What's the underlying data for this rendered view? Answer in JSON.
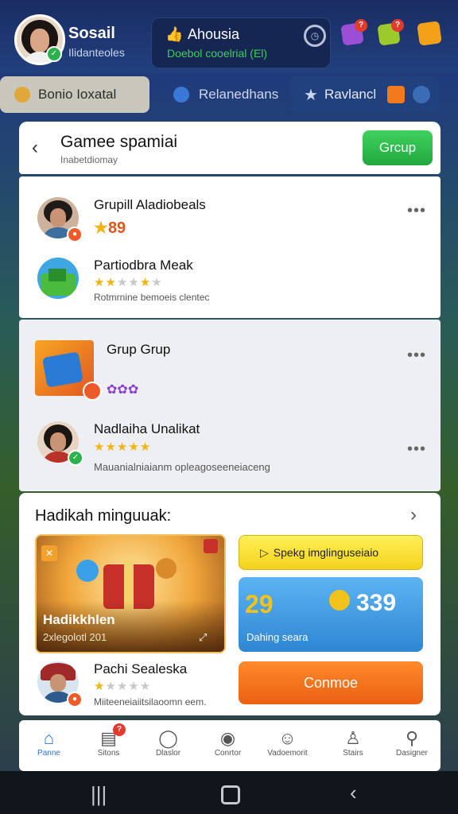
{
  "header": {
    "user_name": "Sosail",
    "user_sub": "Ilidanteoles",
    "status_title": "Ahousia",
    "status_sub": "Doebol cooelrial (El)",
    "gem_badges": [
      "?",
      "?"
    ]
  },
  "tabs": [
    {
      "label": "Bonio Ioxatal"
    },
    {
      "label": "Relanedhans"
    },
    {
      "label": "Ravlancl"
    }
  ],
  "main": {
    "title": "Gamee spamiai",
    "subtitle": "Inabetdiomay",
    "group_button": "Grcup"
  },
  "rows": [
    {
      "title": "Grupill Aladiobeals",
      "score": "89",
      "more": "•••"
    },
    {
      "title": "Partiodbra Meak",
      "sub": "Rotmrnine bemoeis clentec",
      "rating": 3
    },
    {
      "title": "Grup Grup",
      "more": "•••"
    },
    {
      "title": "Nadlaiha Unalikat",
      "sub": "Mauanialniaianm opleagoseeneiaceng",
      "rating": 5,
      "more": "•••"
    }
  ],
  "gifts": {
    "title": "Hadikah minguuak:",
    "promo_title": "Hadikkhlen",
    "promo_sub": "2xlegolotl 201",
    "yellow_btn": "Spekg imglinguseiaio",
    "blue_left": "29",
    "blue_right": "339",
    "blue_sub": "Dahing seara",
    "orange_btn": "Conmoe",
    "person_name": "Pachi Sealeska",
    "person_sub": "Miiteeneiaiitsilaoomn eem.",
    "person_rating": 1
  },
  "nav": [
    {
      "label": "Panne",
      "icon": "home-icon"
    },
    {
      "label": "Sitons",
      "icon": "calendar-icon",
      "badge": "?"
    },
    {
      "label": "Dlaslor",
      "icon": "chat-icon"
    },
    {
      "label": "Conrtor",
      "icon": "location-icon"
    },
    {
      "label": "Vadoemorit",
      "icon": "face-icon"
    },
    {
      "label": "Stairs",
      "icon": "person-icon"
    },
    {
      "label": "Dasigner",
      "icon": "profile-icon"
    }
  ],
  "colors": {
    "accent": "#2a72d6",
    "green": "#2bb24c",
    "orange": "#f07a1c"
  }
}
